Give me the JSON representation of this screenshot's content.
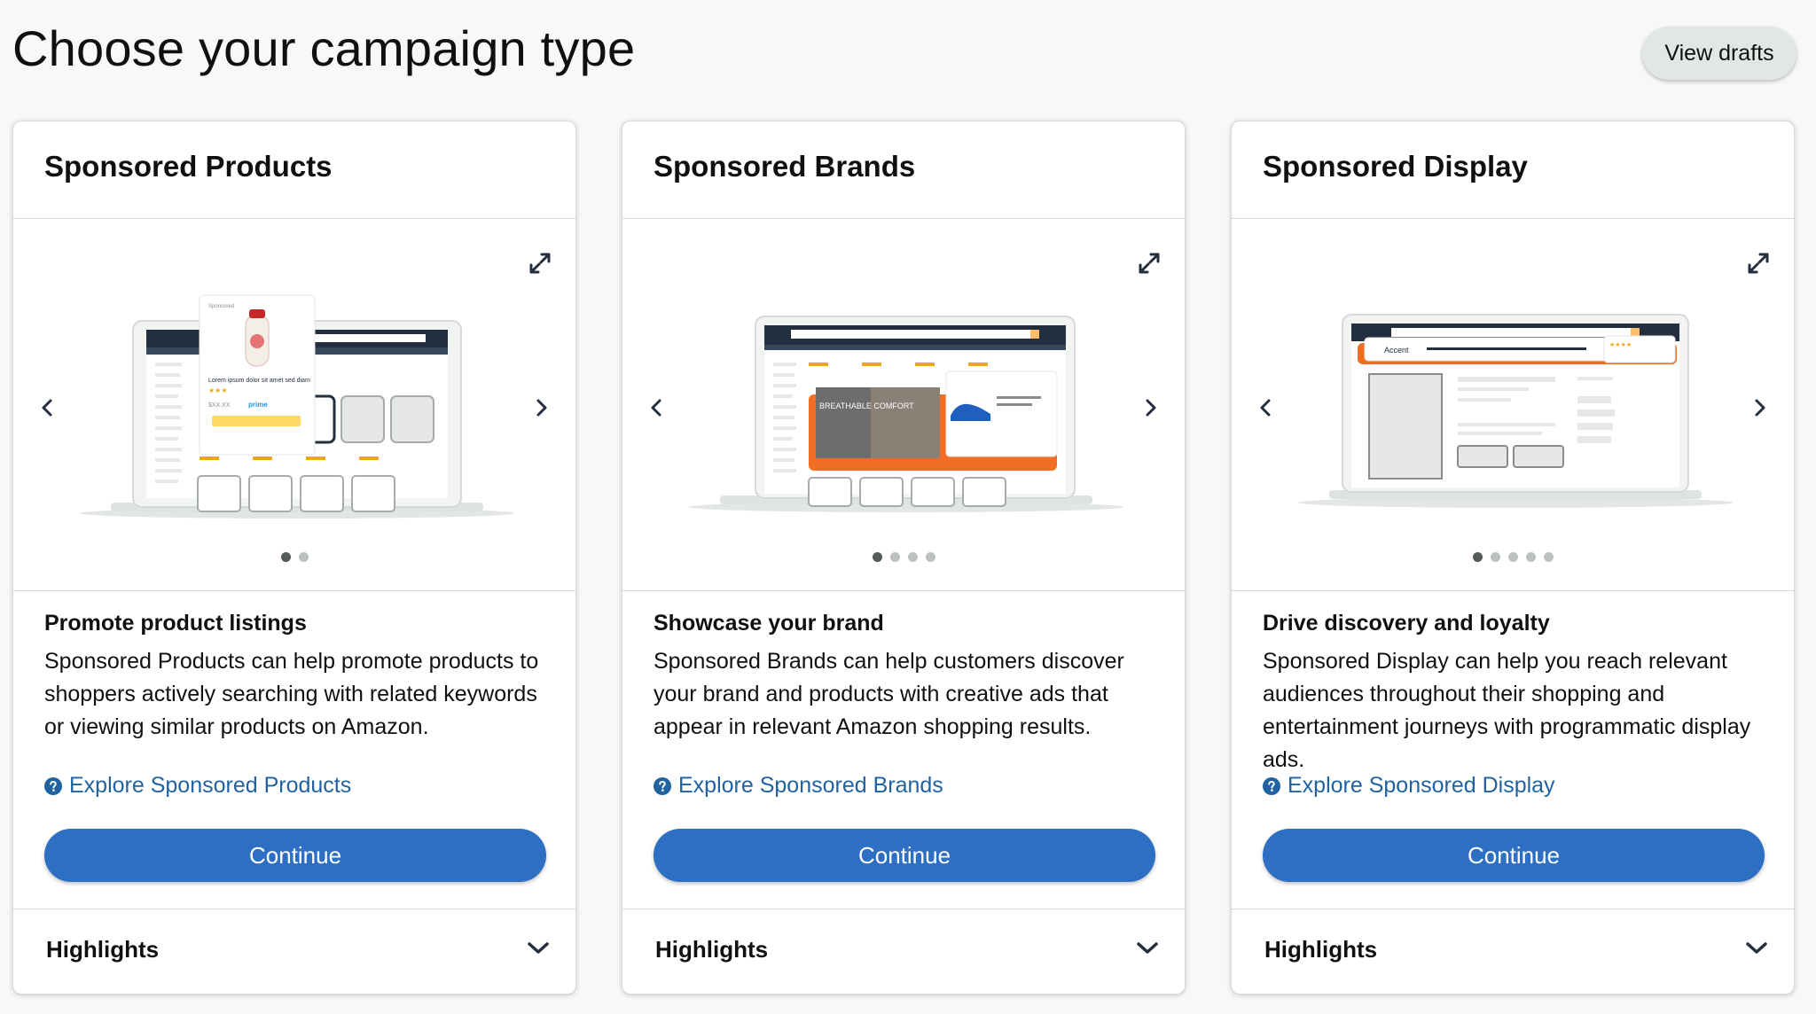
{
  "page": {
    "title": "Choose your campaign type",
    "view_drafts_label": "View drafts"
  },
  "cards": [
    {
      "title": "Sponsored Products",
      "subtitle": "Promote product listings",
      "description": "Sponsored Products can help promote products to shoppers actively searching with related keywords or viewing similar products on Amazon.",
      "explore_label": "Explore Sponsored Products",
      "continue_label": "Continue",
      "highlights_label": "Highlights",
      "slide_count": 2,
      "active_slide": 1,
      "illustration": {
        "popup_sponsored": "Sponsored",
        "popup_text": "Lorem ipsum dolor sit amet sed diam",
        "popup_price": "$XX.XX",
        "popup_prime": "prime"
      }
    },
    {
      "title": "Sponsored Brands",
      "subtitle": "Showcase your brand",
      "description": "Sponsored Brands can help customers discover your brand and products with creative ads that appear in relevant Amazon shopping results.",
      "explore_label": "Explore Sponsored Brands",
      "continue_label": "Continue",
      "highlights_label": "Highlights",
      "slide_count": 4,
      "active_slide": 1,
      "illustration": {
        "banner_text": "BREATHABLE COMFORT"
      }
    },
    {
      "title": "Sponsored Display",
      "subtitle": "Drive discovery and loyalty",
      "description": "Sponsored Display can help you reach relevant audiences throughout their shopping and entertainment journeys with programmatic display ads.",
      "explore_label": "Explore Sponsored Display",
      "continue_label": "Continue",
      "highlights_label": "Highlights",
      "slide_count": 5,
      "active_slide": 1,
      "illustration": {
        "brand_name": "Accent"
      }
    }
  ],
  "colors": {
    "link": "#2162a1",
    "primary_button": "#2c6fc3",
    "accent_orange": "#f06d23",
    "amazon_dark": "#232f3e"
  }
}
